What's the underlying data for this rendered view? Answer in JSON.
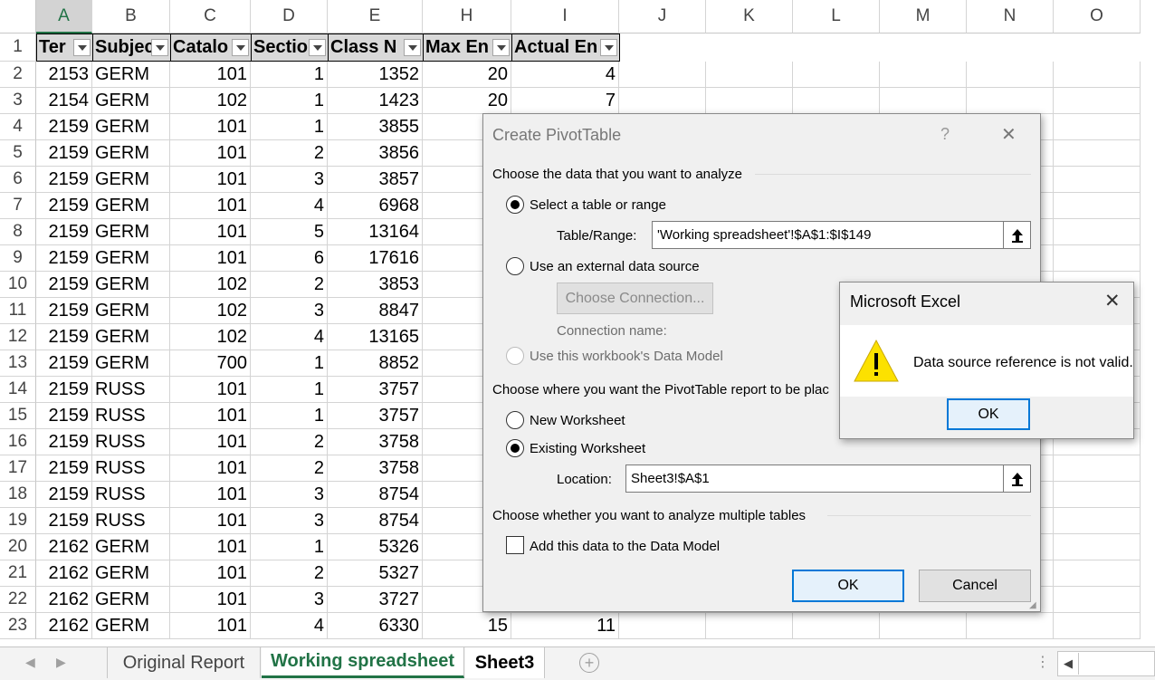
{
  "columns": [
    "A",
    "B",
    "C",
    "D",
    "E",
    "H",
    "I",
    "J",
    "K",
    "L",
    "M",
    "N",
    "O"
  ],
  "header_row": [
    "Term",
    "Subject",
    "Catalog",
    "Section",
    "Class Nbr",
    "Max Enrl",
    "Actual Enrl"
  ],
  "header_row_display": [
    "Ter",
    "Subjec",
    "Catalo",
    "Sectio",
    "Class N",
    "Max En",
    "Actual En"
  ],
  "rows": [
    {
      "num": "1"
    },
    {
      "num": "2",
      "cells": [
        "2153",
        "GERM",
        "101",
        "1",
        "1352",
        "20",
        "4"
      ]
    },
    {
      "num": "3",
      "cells": [
        "2154",
        "GERM",
        "102",
        "1",
        "1423",
        "20",
        "7"
      ]
    },
    {
      "num": "4",
      "cells": [
        "2159",
        "GERM",
        "101",
        "1",
        "3855",
        "",
        ""
      ]
    },
    {
      "num": "5",
      "cells": [
        "2159",
        "GERM",
        "101",
        "2",
        "3856",
        "",
        ""
      ]
    },
    {
      "num": "6",
      "cells": [
        "2159",
        "GERM",
        "101",
        "3",
        "3857",
        "",
        ""
      ]
    },
    {
      "num": "7",
      "cells": [
        "2159",
        "GERM",
        "101",
        "4",
        "6968",
        "",
        ""
      ]
    },
    {
      "num": "8",
      "cells": [
        "2159",
        "GERM",
        "101",
        "5",
        "13164",
        "",
        ""
      ]
    },
    {
      "num": "9",
      "cells": [
        "2159",
        "GERM",
        "101",
        "6",
        "17616",
        "",
        ""
      ]
    },
    {
      "num": "10",
      "cells": [
        "2159",
        "GERM",
        "102",
        "2",
        "3853",
        "",
        ""
      ]
    },
    {
      "num": "11",
      "cells": [
        "2159",
        "GERM",
        "102",
        "3",
        "8847",
        "",
        ""
      ]
    },
    {
      "num": "12",
      "cells": [
        "2159",
        "GERM",
        "102",
        "4",
        "13165",
        "",
        ""
      ]
    },
    {
      "num": "13",
      "cells": [
        "2159",
        "GERM",
        "700",
        "1",
        "8852",
        "",
        ""
      ]
    },
    {
      "num": "14",
      "cells": [
        "2159",
        "RUSS",
        "101",
        "1",
        "3757",
        "",
        ""
      ]
    },
    {
      "num": "15",
      "cells": [
        "2159",
        "RUSS",
        "101",
        "1",
        "3757",
        "",
        ""
      ]
    },
    {
      "num": "16",
      "cells": [
        "2159",
        "RUSS",
        "101",
        "2",
        "3758",
        "",
        ""
      ]
    },
    {
      "num": "17",
      "cells": [
        "2159",
        "RUSS",
        "101",
        "2",
        "3758",
        "",
        ""
      ]
    },
    {
      "num": "18",
      "cells": [
        "2159",
        "RUSS",
        "101",
        "3",
        "8754",
        "",
        ""
      ]
    },
    {
      "num": "19",
      "cells": [
        "2159",
        "RUSS",
        "101",
        "3",
        "8754",
        "",
        ""
      ]
    },
    {
      "num": "20",
      "cells": [
        "2162",
        "GERM",
        "101",
        "1",
        "5326",
        "",
        ""
      ]
    },
    {
      "num": "21",
      "cells": [
        "2162",
        "GERM",
        "101",
        "2",
        "5327",
        "",
        ""
      ]
    },
    {
      "num": "22",
      "cells": [
        "2162",
        "GERM",
        "101",
        "3",
        "3727",
        "",
        ""
      ]
    },
    {
      "num": "23",
      "cells": [
        "2162",
        "GERM",
        "101",
        "4",
        "6330",
        "15",
        "11"
      ]
    }
  ],
  "tabs": {
    "original": "Original Report",
    "working": "Working spreadsheet",
    "sheet3": "Sheet3"
  },
  "pivot": {
    "title": "Create PivotTable",
    "help": "?",
    "close": "✕",
    "section1": "Choose the data that you want to analyze",
    "opt_table": "Select a table or range",
    "table_range_label": "Table/Range:",
    "table_range_value": "'Working spreadsheet'!$A$1:$I$149",
    "opt_external": "Use an external data source",
    "choose_connection": "Choose Connection...",
    "connection_name": "Connection name:",
    "opt_datamodel": "Use this workbook's Data Model",
    "section2": "Choose where you want the PivotTable report to be plac",
    "opt_new": "New Worksheet",
    "opt_existing": "Existing Worksheet",
    "location_label": "Location:",
    "location_value": "Sheet3!$A$1",
    "section3": "Choose whether you want to analyze multiple tables",
    "add_model": "Add this data to the Data Model",
    "ok": "OK",
    "cancel": "Cancel"
  },
  "alert": {
    "title": "Microsoft Excel",
    "message": "Data source reference is not valid.",
    "ok": "OK",
    "close": "✕"
  },
  "colors": {
    "excel_green": "#217346",
    "accent_blue": "#0078d7",
    "warning_yellow": "#fce100"
  }
}
